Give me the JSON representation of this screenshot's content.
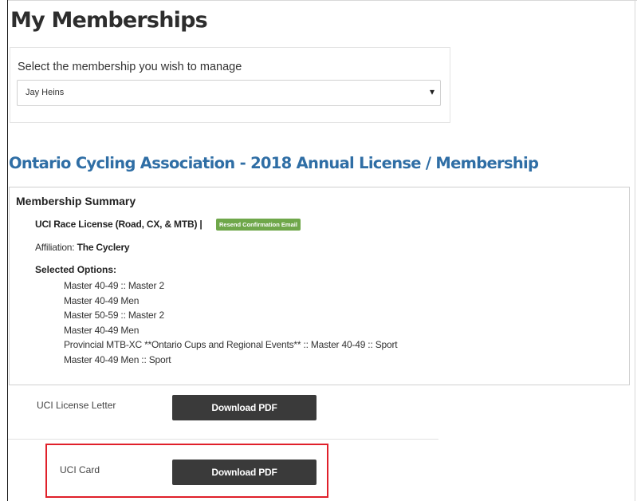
{
  "page": {
    "title": "My Memberships"
  },
  "membership_select": {
    "label": "Select the membership you wish to manage",
    "selected": "Jay Heins"
  },
  "membership": {
    "title": "Ontario Cycling Association - 2018 Annual License / Membership",
    "summary": {
      "heading": "Membership Summary",
      "license": "UCI Race License (Road, CX, & MTB) |",
      "resend_label": "Resend Confirmation Email",
      "affiliation_label": "Affiliation:",
      "affiliation_value": "The Cyclery",
      "options_heading": "Selected Options:",
      "options": [
        "Master 40-49 :: Master 2",
        "Master 40-49 Men",
        "Master 50-59 :: Master 2",
        "Master 40-49 Men",
        "Provincial MTB-XC **Ontario Cups and Regional Events** :: Master 40-49 :: Sport",
        "Master 40-49 Men :: Sport"
      ]
    },
    "documents": [
      {
        "label": "UCI License Letter",
        "button": "Download PDF"
      },
      {
        "label": "UCI Card",
        "button": "Download PDF"
      }
    ]
  },
  "colors": {
    "section_title": "#2f6ea5",
    "resend_button": "#6fa74a",
    "download_button": "#3a3a3a",
    "highlight": "#e0202a"
  }
}
